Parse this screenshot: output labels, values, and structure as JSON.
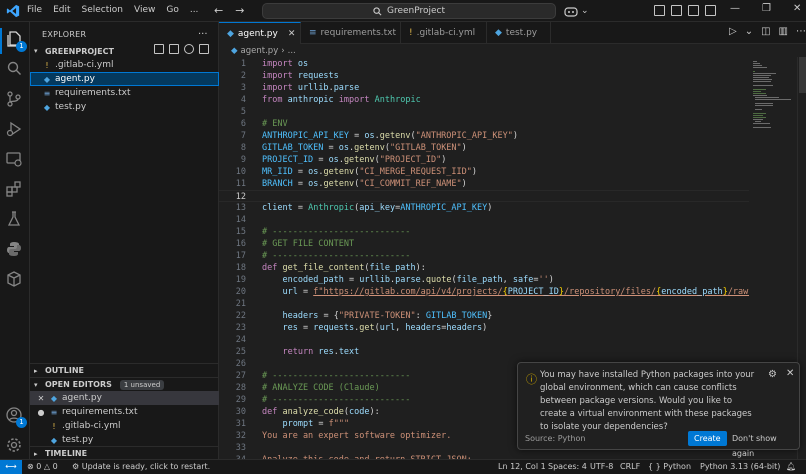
{
  "titlebar": {
    "menu": [
      "File",
      "Edit",
      "Selection",
      "View",
      "Go"
    ],
    "more": "...",
    "search_text": "GreenProject"
  },
  "activity": {
    "explorer_badge": "1",
    "accounts_badge": "1"
  },
  "sidebar": {
    "title": "EXPLORER",
    "more": "...",
    "project": "GREENPROJECT",
    "files": [
      {
        "name": ".gitlab-ci.yml",
        "icon": "yml-file-icon"
      },
      {
        "name": "agent.py",
        "icon": "python-file-icon",
        "selected": true
      },
      {
        "name": "requirements.txt",
        "icon": "text-file-icon"
      },
      {
        "name": "test.py",
        "icon": "python-file-icon"
      }
    ],
    "outline": "OUTLINE",
    "open_editors": "OPEN EDITORS",
    "unsaved_badge": "1 unsaved",
    "open_files": [
      {
        "name": "agent.py",
        "mark": "✕"
      },
      {
        "name": "requirements.txt",
        "mark": "●"
      },
      {
        "name": ".gitlab-ci.yml",
        "mark": ""
      },
      {
        "name": "test.py",
        "mark": ""
      }
    ],
    "timeline": "TIMELINE"
  },
  "tabs": [
    {
      "label": "agent.py",
      "active": true
    },
    {
      "label": "requirements.txt",
      "active": false
    },
    {
      "label": ".gitlab-ci.yml",
      "active": false
    },
    {
      "label": "test.py",
      "active": false
    }
  ],
  "breadcrumb": {
    "file": "agent.py",
    "rest": "..."
  },
  "code_lines": [
    "import os",
    "import requests",
    "import urllib.parse",
    "from anthropic import Anthropic",
    "",
    "# ENV",
    "ANTHROPIC_API_KEY = os.getenv(\"ANTHROPIC_API_KEY\")",
    "GITLAB_TOKEN = os.getenv(\"GITLAB_TOKEN\")",
    "PROJECT_ID = os.getenv(\"PROJECT_ID\")",
    "MR_IID = os.getenv(\"CI_MERGE_REQUEST_IID\")",
    "BRANCH = os.getenv(\"CI_COMMIT_REF_NAME\")",
    "",
    "client = Anthropic(api_key=ANTHROPIC_API_KEY)",
    "",
    "# ---------------------------",
    "# GET FILE CONTENT",
    "# ---------------------------",
    "def get_file_content(file_path):",
    "    encoded_path = urllib.parse.quote(file_path, safe='')",
    "    url = f\"https://gitlab.com/api/v4/projects/{PROJECT_ID}/repository/files/{encoded_path}/raw?ref={",
    "",
    "    headers = {\"PRIVATE-TOKEN\": GITLAB_TOKEN}",
    "    res = requests.get(url, headers=headers)",
    "",
    "    return res.text",
    "",
    "# ---------------------------",
    "# ANALYZE CODE (Claude)",
    "# ---------------------------",
    "def analyze_code(code):",
    "    prompt = f\"\"\"",
    "You are an expert software optimizer.",
    "",
    "Analyze this code and return STRICT JSON:"
  ],
  "current_line": 12,
  "notification": {
    "message": "You may have installed Python packages into your global environment, which can cause conflicts between package versions. Would you like to create a virtual environment with these packages to isolate your dependencies?",
    "source": "Source: Python",
    "primary_label": "Create",
    "secondary_label": "Don't show again"
  },
  "statusbar": {
    "errors": "0",
    "warnings": "0",
    "update": "Update is ready, click to restart.",
    "position": "Ln 12, Col 1",
    "spaces": "Spaces: 4",
    "encoding": "UTF-8",
    "eol": "CRLF",
    "language": "Python",
    "interpreter": "3.13 (64-bit)"
  },
  "colors": {
    "accent": "#0078d4",
    "warning": "#cca700",
    "background": "#1f1f1f"
  }
}
